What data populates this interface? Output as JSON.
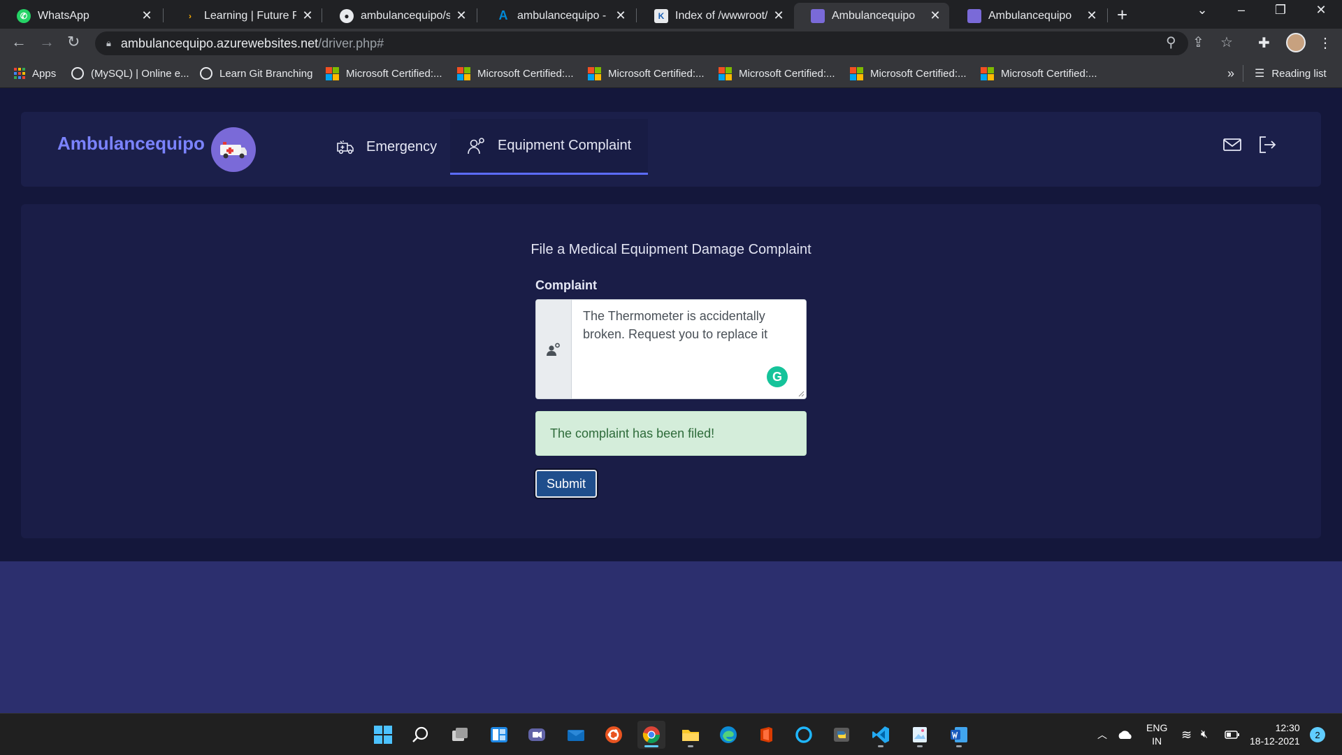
{
  "browser": {
    "tabs": [
      {
        "title": "WhatsApp",
        "active": false
      },
      {
        "title": "Learning | Future Read",
        "active": false
      },
      {
        "title": "ambulancequipo/start",
        "active": false
      },
      {
        "title": "ambulancequipo - Mi",
        "active": false
      },
      {
        "title": "Index of /wwwroot/",
        "active": false
      },
      {
        "title": "Ambulancequipo",
        "active": true
      },
      {
        "title": "Ambulancequipo",
        "active": false
      }
    ],
    "new_tab": "+",
    "close_glyph": "✕",
    "url_host": "ambulancequipo.azurewebsites.net",
    "url_path": "/driver.php#",
    "bookmarks": [
      "Apps",
      "(MySQL) | Online e...",
      "Learn Git Branching",
      "Microsoft Certified:...",
      "Microsoft Certified:...",
      "Microsoft Certified:...",
      "Microsoft Certified:...",
      "Microsoft Certified:...",
      "Microsoft Certified:..."
    ],
    "bookmarks_overflow": "»",
    "reading_list": "Reading list"
  },
  "app": {
    "brand": "Ambulancequipo",
    "nav": [
      {
        "label": "Emergency",
        "icon": "ambulance-icon",
        "active": false
      },
      {
        "label": "Equipment Complaint",
        "icon": "technician-icon",
        "active": true
      }
    ],
    "header_icons": [
      "mail-icon",
      "logout-icon"
    ]
  },
  "form": {
    "title": "File a Medical Equipment Damage Complaint",
    "complaint_label": "Complaint",
    "complaint_value": "The Thermometer is accidentally broken. Request you to replace it",
    "alert": "The complaint has been filed!",
    "submit_label": "Submit"
  },
  "taskbar": {
    "apps": [
      "windows-start-icon",
      "search-icon",
      "task-view-icon",
      "widgets-icon",
      "teams-chat-icon",
      "mail-icon",
      "ubuntu-icon",
      "chrome-icon",
      "file-explorer-icon",
      "edge-icon",
      "office-icon",
      "cortana-icon",
      "python-icon",
      "vscode-icon",
      "paint-icon",
      "word-icon"
    ],
    "lang_top": "ENG",
    "lang_bottom": "IN",
    "time": "12:30",
    "date": "18-12-2021",
    "notifications": "2"
  },
  "colors": {
    "brand": "#7b83ff",
    "nav_active_underline": "#5c6cff",
    "alert_bg": "#d4edda",
    "alert_text": "#2e6b3a",
    "submit_bg": "#1f4e8c",
    "page_bg_top": "#14173b",
    "page_bg_bottom": "#2c2f6e"
  }
}
